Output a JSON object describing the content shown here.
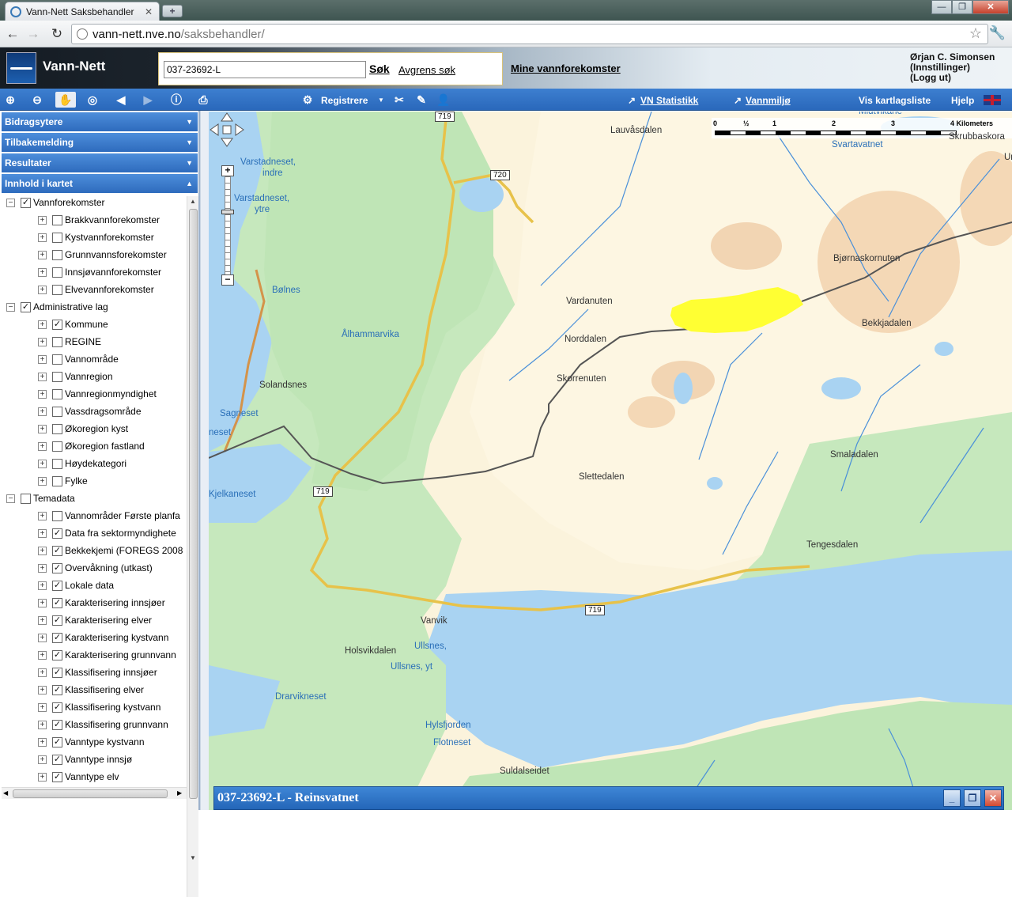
{
  "browser": {
    "tab_title": "Vann-Nett Saksbehandler",
    "url_host": "vann-nett.nve.no",
    "url_path": "/saksbehandler/"
  },
  "app": {
    "title": "Vann-Nett",
    "search_value": "037-23692-L",
    "search_button": "Søk",
    "refine_link": "Avgrens søk",
    "my_water_link": "Mine vannforekomster",
    "user": {
      "name": "Ørjan C. Simonsen",
      "settings": "(Innstillinger)",
      "logout": "(Logg ut)"
    }
  },
  "toolbar": {
    "register": "Registrere",
    "vn_stats": "VN Statistikk",
    "vannmiljo": "Vannmiljø",
    "layer_list": "Vis kartlagsliste",
    "help": "Hjelp"
  },
  "sidebar": {
    "panels": [
      "Bidragsytere",
      "Tilbakemelding",
      "Resultater",
      "Innhold i kartet"
    ],
    "tree": [
      {
        "level": 0,
        "label": "Vannforekomster",
        "checked": true,
        "expanded": true
      },
      {
        "level": 1,
        "label": "Brakkvannforekomster",
        "checked": false
      },
      {
        "level": 1,
        "label": "Kystvannforekomster",
        "checked": false
      },
      {
        "level": 1,
        "label": "Grunnvannsforekomster",
        "checked": false
      },
      {
        "level": 1,
        "label": "Innsjøvannforekomster",
        "checked": false
      },
      {
        "level": 1,
        "label": "Elvevannforekomster",
        "checked": false
      },
      {
        "level": 0,
        "label": "Administrative lag",
        "checked": true,
        "expanded": true
      },
      {
        "level": 1,
        "label": "Kommune",
        "checked": true
      },
      {
        "level": 1,
        "label": "REGINE",
        "checked": false
      },
      {
        "level": 1,
        "label": "Vannområde",
        "checked": false
      },
      {
        "level": 1,
        "label": "Vannregion",
        "checked": false
      },
      {
        "level": 1,
        "label": "Vannregionmyndighet",
        "checked": false
      },
      {
        "level": 1,
        "label": "Vassdragsområde",
        "checked": false
      },
      {
        "level": 1,
        "label": "Økoregion kyst",
        "checked": false
      },
      {
        "level": 1,
        "label": "Økoregion fastland",
        "checked": false
      },
      {
        "level": 1,
        "label": "Høydekategori",
        "checked": false
      },
      {
        "level": 1,
        "label": "Fylke",
        "checked": false
      },
      {
        "level": 0,
        "label": "Temadata",
        "checked": false,
        "expanded": true
      },
      {
        "level": 1,
        "label": "Vannområder Første planfa",
        "checked": false
      },
      {
        "level": 1,
        "label": "Data fra sektormyndighete",
        "checked": true
      },
      {
        "level": 1,
        "label": "Bekkekjemi (FOREGS 2008",
        "checked": true
      },
      {
        "level": 1,
        "label": "Overvåkning (utkast)",
        "checked": true
      },
      {
        "level": 1,
        "label": "Lokale data",
        "checked": true
      },
      {
        "level": 1,
        "label": "Karakterisering innsjøer",
        "checked": true
      },
      {
        "level": 1,
        "label": "Karakterisering elver",
        "checked": true
      },
      {
        "level": 1,
        "label": "Karakterisering kystvann",
        "checked": true
      },
      {
        "level": 1,
        "label": "Karakterisering grunnvann",
        "checked": true
      },
      {
        "level": 1,
        "label": "Klassifisering innsjøer",
        "checked": true
      },
      {
        "level": 1,
        "label": "Klassifisering elver",
        "checked": true
      },
      {
        "level": 1,
        "label": "Klassifisering kystvann",
        "checked": true
      },
      {
        "level": 1,
        "label": "Klassifisering grunnvann",
        "checked": true
      },
      {
        "level": 1,
        "label": "Vanntype kystvann",
        "checked": true
      },
      {
        "level": 1,
        "label": "Vanntype innsjø",
        "checked": true
      },
      {
        "level": 1,
        "label": "Vanntype elv",
        "checked": true
      }
    ]
  },
  "map": {
    "scale_ticks": [
      "0",
      "½",
      "1",
      "2",
      "3",
      "4 Kilometers"
    ],
    "labels": [
      {
        "text": "Lauvåsdalen",
        "kind": "land"
      },
      {
        "text": "Varstadneset,",
        "kind": "water"
      },
      {
        "text": "indre",
        "kind": "water"
      },
      {
        "text": "Varstadneset,",
        "kind": "water"
      },
      {
        "text": "ytre",
        "kind": "water"
      },
      {
        "text": "Bølnes",
        "kind": "water"
      },
      {
        "text": "Ålhammarvika",
        "kind": "water"
      },
      {
        "text": "Solandsnes",
        "kind": "land"
      },
      {
        "text": "Sagneset",
        "kind": "water"
      },
      {
        "text": "neset",
        "kind": "water"
      },
      {
        "text": "Kjelkaneset",
        "kind": "water"
      },
      {
        "text": "Vardanuten",
        "kind": "land"
      },
      {
        "text": "Norddalen",
        "kind": "land"
      },
      {
        "text": "Skorrenuten",
        "kind": "land"
      },
      {
        "text": "Bjørnaskornuten",
        "kind": "land"
      },
      {
        "text": "Bekkjadalen",
        "kind": "land"
      },
      {
        "text": "Svartavatnet",
        "kind": "water"
      },
      {
        "text": "Midtvikane",
        "kind": "water"
      },
      {
        "text": "Skrubbaskora",
        "kind": "land"
      },
      {
        "text": "Urda",
        "kind": "land"
      },
      {
        "text": "Smaladalen",
        "kind": "land"
      },
      {
        "text": "Slettedalen",
        "kind": "land"
      },
      {
        "text": "Tengesdalen",
        "kind": "land"
      },
      {
        "text": "Vanvik",
        "kind": "land"
      },
      {
        "text": "Holsvikdalen",
        "kind": "land"
      },
      {
        "text": "Ullsnes,",
        "kind": "water"
      },
      {
        "text": "Ullsnes, yt",
        "kind": "water"
      },
      {
        "text": "Drarvikneset",
        "kind": "water"
      },
      {
        "text": "Hylsfjorden",
        "kind": "water"
      },
      {
        "text": "Flotneset",
        "kind": "water"
      },
      {
        "text": "Suldalseidet",
        "kind": "land"
      }
    ],
    "road_numbers": [
      "719",
      "720",
      "719",
      "719"
    ]
  },
  "result_panel": {
    "title": "037-23692-L - Reinsvatnet"
  },
  "colors": {
    "toolbar": "#2f70c2",
    "water": "#a9d3f2",
    "forest": "#bfe5b6",
    "highlight": "#ffff33"
  }
}
